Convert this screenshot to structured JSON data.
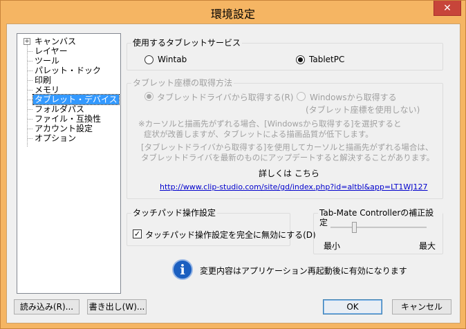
{
  "window": {
    "title": "環境設定",
    "close_glyph": "✕"
  },
  "tree": {
    "expander_glyph": "+",
    "items": [
      {
        "label": "キャンバス"
      },
      {
        "label": "レイヤー"
      },
      {
        "label": "ツール"
      },
      {
        "label": "パレット・ドック"
      },
      {
        "label": "印刷"
      },
      {
        "label": "メモリ"
      },
      {
        "label": "タブレット・デバイス"
      },
      {
        "label": "フォルダパス"
      },
      {
        "label": "ファイル・互換性"
      },
      {
        "label": "アカウント設定"
      },
      {
        "label": "オプション"
      }
    ],
    "selected_index": 6
  },
  "tablet_service": {
    "title": "使用するタブレットサービス",
    "options": [
      {
        "label": "Wintab",
        "checked": false
      },
      {
        "label": "TabletPC",
        "checked": true
      }
    ]
  },
  "coordinates": {
    "title": "タブレット座標の取得方法",
    "option_driver": "タブレットドライバから取得する(R)",
    "option_windows": "Windowsから取得する",
    "option_windows_sub": "(タブレット座標を使用しない)",
    "note1_line1": "※カーソルと描画先がずれる場合、[Windowsから取得する]を選択すると",
    "note1_line2": "症状が改善しますが、タブレットによる描画品質が低下します。",
    "note2_line1": "[タブレットドライバから取得する]を使用してカーソルと描画先がずれる場合は、",
    "note2_line2": "タブレットドライバを最新のものにアップデートすると解決することがあります。",
    "details_label": "詳しくは こちら",
    "link": "http://www.clip-studio.com/site/gd/index.php?id=altbl&app=LT1WJ127"
  },
  "touchpad": {
    "title": "タッチパッド操作設定",
    "checkbox_label": "タッチパッド操作設定を完全に無効にする(D)",
    "checked": true,
    "check_glyph": "✓"
  },
  "tabmate": {
    "title": "Tab-Mate Controllerの補正設定",
    "min_label": "最小",
    "max_label": "最大",
    "value_fraction": 0.25
  },
  "info": {
    "icon_glyph": "i",
    "message": "変更内容はアプリケーション再起動後に有効になります"
  },
  "buttons": {
    "load": "読み込み(R)...",
    "export": "書き出し(W)...",
    "ok": "OK",
    "cancel": "キャンセル"
  }
}
